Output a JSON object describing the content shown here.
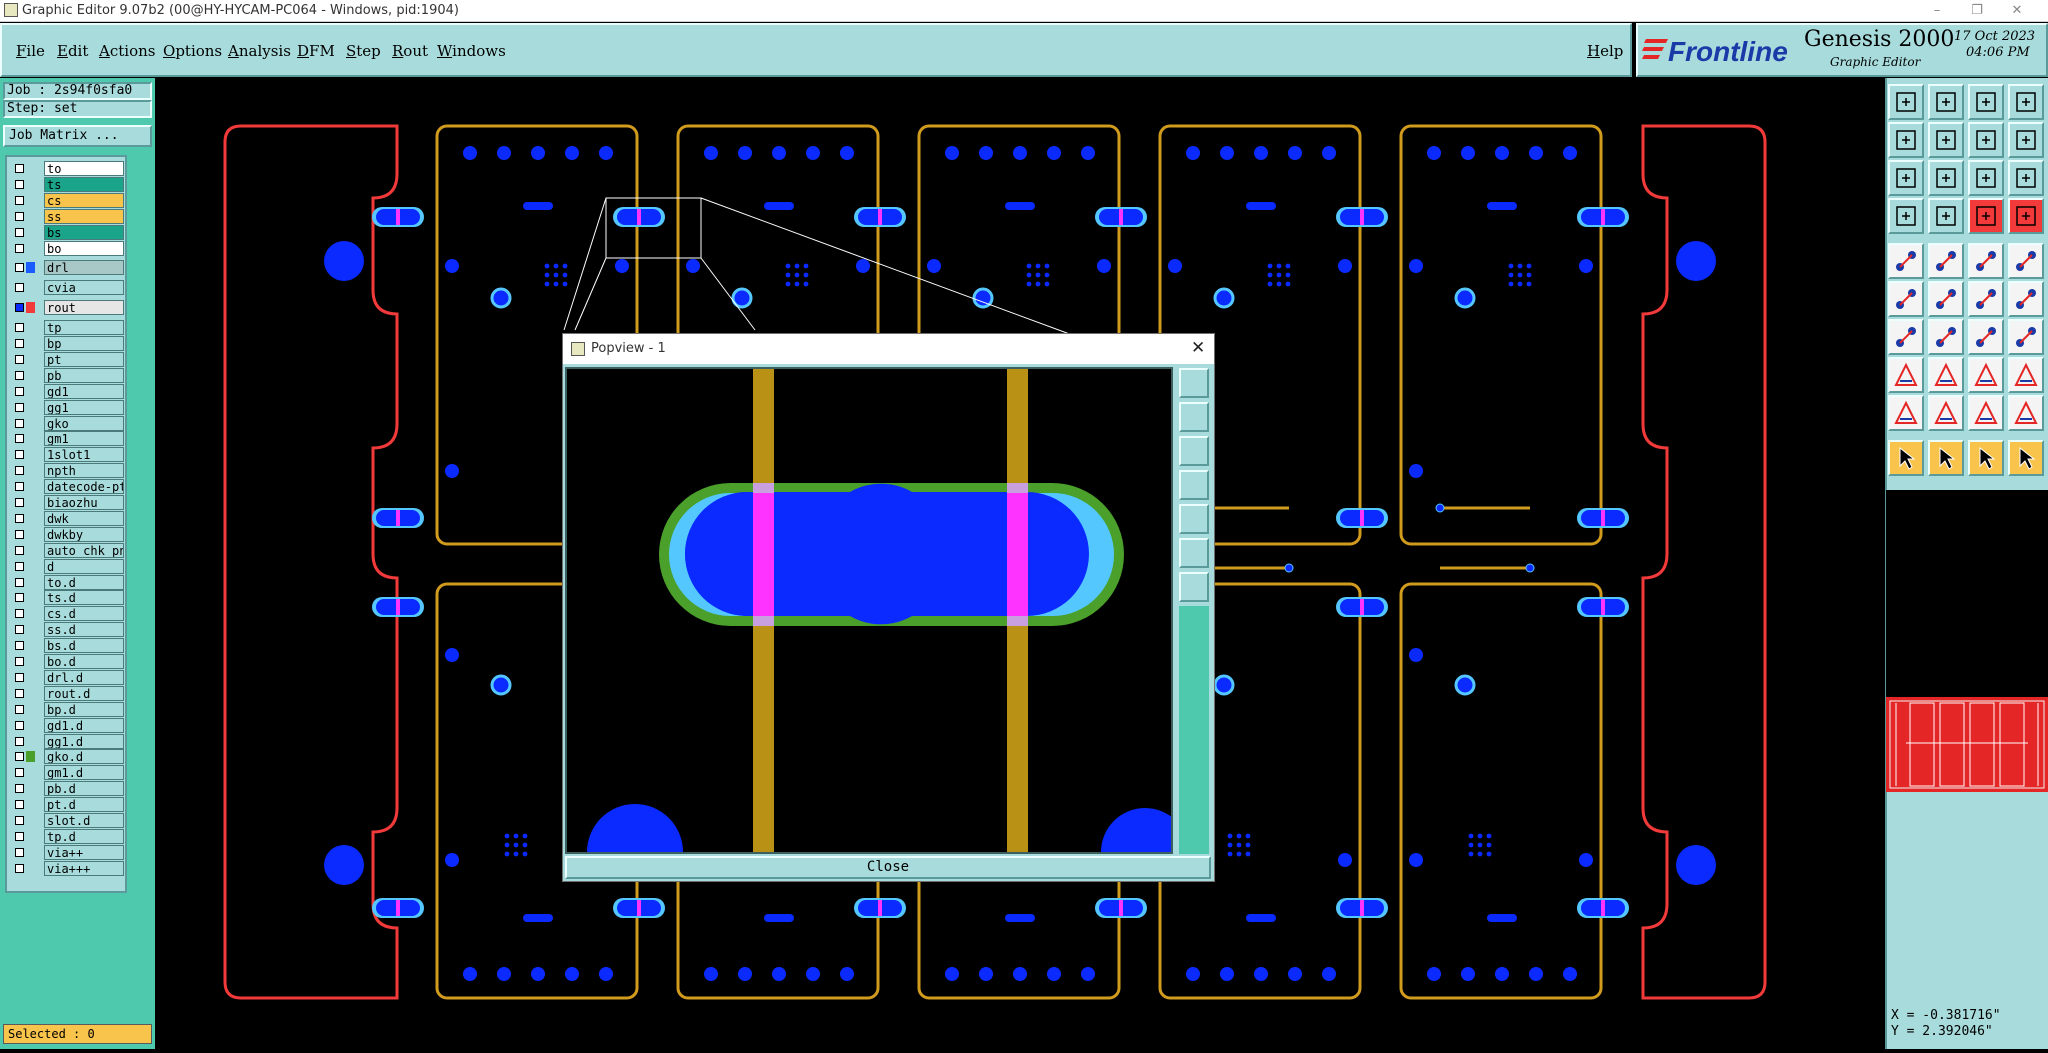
{
  "window": {
    "title": "Graphic Editor 9.07b2 (00@HY-HYCAM-PC064 - Windows, pid:1904)",
    "minimize": "–",
    "restore": "❐",
    "close": "✕"
  },
  "menu": {
    "items": [
      "File",
      "Edit",
      "Actions",
      "Options",
      "Analysis",
      "DFM",
      "Step",
      "Rout",
      "Windows"
    ],
    "help": "Help"
  },
  "logo": {
    "brand": "Frontline",
    "product": "Genesis 2000",
    "subtitle": "Graphic Editor",
    "date": "17 Oct 2023",
    "time": "04:06 PM"
  },
  "job": {
    "job_label": "Job : 2s94f0sfa0",
    "step_label": "Step: set",
    "matrix_button": "Job Matrix ..."
  },
  "layers": [
    {
      "name": "to",
      "bg": "#ffffff"
    },
    {
      "name": "ts",
      "bg": "#1aa58a"
    },
    {
      "name": "cs",
      "bg": "#f9c44c"
    },
    {
      "name": "ss",
      "bg": "#f9c44c"
    },
    {
      "name": "bs",
      "bg": "#1aa58a"
    },
    {
      "name": "bo",
      "bg": "#ffffff"
    },
    {
      "name": "drl",
      "bg": "#a8c8c8",
      "color": "#1a5cff",
      "gap": true
    },
    {
      "name": "cvia",
      "bg": "#a8dcdc",
      "gap": true
    },
    {
      "name": "rout",
      "bg": "#e6e6e6",
      "color": "#f23a3a",
      "active": true,
      "gap": true
    },
    {
      "name": "tp",
      "bg": "#a8dcdc",
      "gap": true
    },
    {
      "name": "bp",
      "bg": "#a8dcdc"
    },
    {
      "name": "pt",
      "bg": "#a8dcdc"
    },
    {
      "name": "pb",
      "bg": "#a8dcdc"
    },
    {
      "name": "gd1",
      "bg": "#a8dcdc"
    },
    {
      "name": "gg1",
      "bg": "#a8dcdc"
    },
    {
      "name": "gko",
      "bg": "#a8dcdc"
    },
    {
      "name": "gm1",
      "bg": "#a8dcdc"
    },
    {
      "name": "1slot1",
      "bg": "#a8dcdc"
    },
    {
      "name": "npth",
      "bg": "#a8dcdc"
    },
    {
      "name": "datecode-pt",
      "bg": "#a8dcdc"
    },
    {
      "name": "biaozhu",
      "bg": "#a8dcdc"
    },
    {
      "name": "dwk",
      "bg": "#a8dcdc"
    },
    {
      "name": "dwkby",
      "bg": "#a8dcdc"
    },
    {
      "name": "auto_chk_pn",
      "bg": "#a8dcdc"
    },
    {
      "name": "d",
      "bg": "#a8dcdc"
    },
    {
      "name": "to.d",
      "bg": "#a8dcdc"
    },
    {
      "name": "ts.d",
      "bg": "#a8dcdc"
    },
    {
      "name": "cs.d",
      "bg": "#a8dcdc"
    },
    {
      "name": "ss.d",
      "bg": "#a8dcdc"
    },
    {
      "name": "bs.d",
      "bg": "#a8dcdc"
    },
    {
      "name": "bo.d",
      "bg": "#a8dcdc"
    },
    {
      "name": "drl.d",
      "bg": "#a8dcdc"
    },
    {
      "name": "rout.d",
      "bg": "#a8dcdc"
    },
    {
      "name": "bp.d",
      "bg": "#a8dcdc"
    },
    {
      "name": "gd1.d",
      "bg": "#a8dcdc"
    },
    {
      "name": "gg1.d",
      "bg": "#a8dcdc"
    },
    {
      "name": "gko.d",
      "bg": "#a8dcdc",
      "color": "#4aa02a"
    },
    {
      "name": "gm1.d",
      "bg": "#a8dcdc"
    },
    {
      "name": "pb.d",
      "bg": "#a8dcdc"
    },
    {
      "name": "pt.d",
      "bg": "#a8dcdc"
    },
    {
      "name": "slot.d",
      "bg": "#a8dcdc"
    },
    {
      "name": "tp.d",
      "bg": "#a8dcdc"
    },
    {
      "name": "via++",
      "bg": "#a8dcdc"
    },
    {
      "name": "via+++",
      "bg": "#a8dcdc"
    }
  ],
  "status": {
    "selected": "Selected : 0"
  },
  "coords": {
    "x": "X = -0.381716\"",
    "y": "Y = 2.392046\""
  },
  "popview": {
    "title": "Popview - 1",
    "close_label": "Close",
    "close_x": "✕"
  },
  "toolbar_icons": [
    "layer-up-icon",
    "layer-down-icon",
    "home-icon",
    "split-view-icon",
    "layer-left-icon",
    "layer-right-icon",
    "redraw-icon",
    "snap-icon",
    "zoom-fit-icon",
    "zoom-center-icon",
    "scale-1to2-icon",
    "help-icon",
    "measure-icon",
    "grid-icon",
    "feature-select-icon",
    "feature-move-icon",
    "delete-feature-icon",
    "pad-edit-icon",
    "dash-line-icon",
    "add-pad-icon",
    "connect-icon",
    "cross-icon",
    "arc-icon",
    "drag-arc-icon",
    "angle-icon",
    "slash-icon",
    "rotate-icon",
    "fields-icon",
    "pad-select-icon",
    "line-icon",
    "resize-icon",
    "copy-icon",
    "tri-a-icon",
    "tri-b-icon",
    "tri-c-icon",
    "tri-d-icon",
    "pointer-icon",
    "pointer-area-icon",
    "pointer-net-icon",
    "pointer-cross-icon"
  ],
  "colors": {
    "bg_panel": "#a8dcdc",
    "bg_left": "#4ec9ae",
    "rout": "#f23a3a",
    "outline": "#d19b1d",
    "pad": "#0a2aff",
    "cyan_pad": "#55c7ff",
    "magenta": "#ff33ff",
    "mask": "#4aa02a"
  }
}
